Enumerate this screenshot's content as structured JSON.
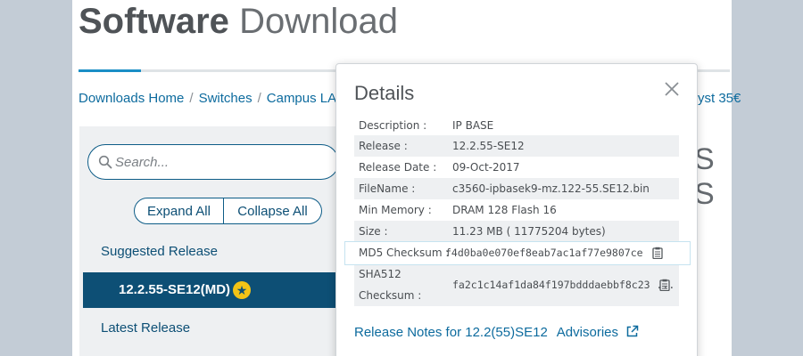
{
  "page": {
    "title_bold": "Software",
    "title_light": "Download",
    "breadcrumb": [
      "Downloads Home",
      "Switches",
      "Campus LA"
    ],
    "breadcrumb_tail": "yst 35€",
    "background_heading_fragment": "S S"
  },
  "sidebar": {
    "search": {
      "placeholder": "Search..."
    },
    "expand_all": "Expand All",
    "collapse_all": "Collapse All",
    "suggested_release_label": "Suggested Release",
    "selected_release": "12.2.55-SE12(MD)",
    "latest_release_label": "Latest Release"
  },
  "modal": {
    "title": "Details",
    "rows": [
      {
        "label": "Description :",
        "value": "IP BASE"
      },
      {
        "label": "Release :",
        "value": "12.2.55-SE12"
      },
      {
        "label": "Release Date :",
        "value": "09-Oct-2017"
      },
      {
        "label": "FileName :",
        "value": "c3560-ipbasek9-mz.122-55.SE12.bin"
      },
      {
        "label": "Min Memory :",
        "value": "DRAM 128 Flash 16"
      },
      {
        "label": "Size :",
        "value": "11.23 MB ( 11775204 bytes)"
      },
      {
        "label": "MD5 Checksum :",
        "value": "f4d0ba0e070ef8eab7ac1af77e9807ce"
      },
      {
        "label_line1": "SHA512",
        "label_line2": "Checksum :",
        "value": "fa2c1c14af1da84f197bdddaebbf8c23 ..."
      }
    ],
    "release_notes_link": "Release Notes for 12.2(55)SE12",
    "advisories_link": "Advisories"
  },
  "colors": {
    "brand_blue": "#0d4f75",
    "link_blue": "#0d6b9e",
    "star_gold": "#f2c316",
    "outer_background": "#c3ccd6"
  }
}
